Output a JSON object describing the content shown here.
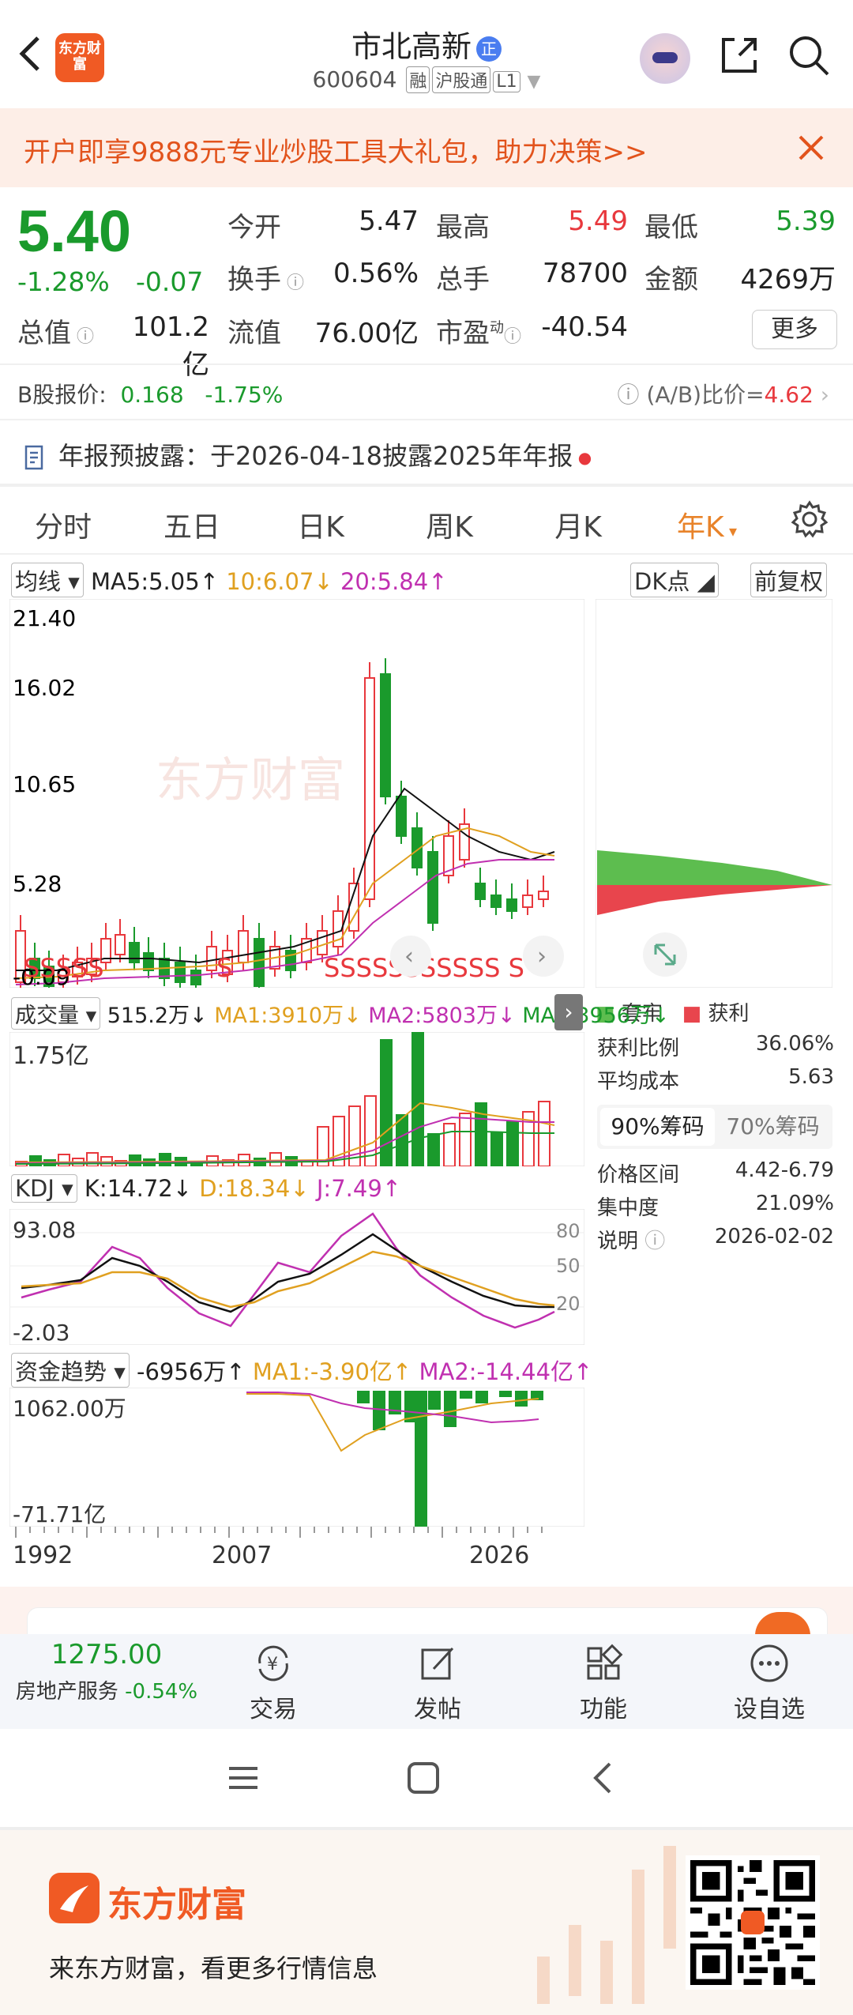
{
  "header": {
    "logo_text": "东方财富",
    "stock_name": "市北高新",
    "badge": "正",
    "stock_code": "600604",
    "tags": [
      "融",
      "沪股通",
      "L1"
    ]
  },
  "banner": {
    "text": "开户即享9888元专业炒股工具大礼包，助力决策>>"
  },
  "quote": {
    "price": "5.40",
    "change_pct": "-1.28%",
    "change": "-0.07",
    "rows": [
      [
        {
          "label": "今开",
          "value": "5.47",
          "color": "#222"
        },
        {
          "label": "最高",
          "value": "5.49",
          "color": "#e8383d"
        },
        {
          "label": "最低",
          "value": "5.39",
          "color": "#1a9a2c"
        }
      ],
      [
        {
          "label": "换手",
          "value": "0.56%",
          "color": "#222"
        },
        {
          "label": "总手",
          "value": "78700",
          "color": "#222"
        },
        {
          "label": "金额",
          "value": "4269万",
          "color": "#222"
        }
      ]
    ],
    "row3": {
      "label1": "总值",
      "value1": "101.2亿",
      "label2": "流值",
      "value2": "76.00亿",
      "label3": "市盈",
      "label3_sup": "动",
      "value3": "-40.54"
    },
    "more_label": "更多"
  },
  "b_share": {
    "label": "B股报价:",
    "price": "0.168",
    "pct": "-1.75%",
    "ratio_label": "(A/B)比价=",
    "ratio_value": "4.62"
  },
  "annual_report": {
    "text": "年报预披露：于2026-04-18披露2025年年报"
  },
  "tabs": [
    "分时",
    "五日",
    "日K",
    "周K",
    "月K",
    "年K"
  ],
  "kchart": {
    "ma_selector": "均线",
    "ma5": "MA5:5.05↑",
    "ma10": "10:6.07↓",
    "ma20": "20:5.84↑",
    "dk_label": "DK点",
    "adjust_label": "前复权",
    "y_labels": [
      "21.40",
      "16.02",
      "10.65",
      "5.28",
      "-0.09"
    ],
    "watermark": "东方财富"
  },
  "chip": {
    "legend_trapped": "套牢",
    "legend_profit": "获利",
    "rows": [
      {
        "label": "获利比例",
        "value": "36.06%"
      },
      {
        "label": "平均成本",
        "value": "5.63"
      }
    ],
    "tab_90": "90%筹码",
    "tab_70": "70%筹码",
    "rows2": [
      {
        "label": "价格区间",
        "value": "4.42-6.79"
      },
      {
        "label": "集中度",
        "value": "21.09%"
      },
      {
        "label": "说明",
        "value": "2026-02-02"
      }
    ]
  },
  "volume": {
    "selector": "成交量",
    "value": "515.2万↓",
    "ma1": "MA1:3910万↓",
    "ma2": "MA2:5803万↓",
    "ma3": "MA3:3956万↓",
    "y_label": "1.75亿"
  },
  "kdj": {
    "selector": "KDJ",
    "k": "K:14.72↓",
    "d": "D:18.34↓",
    "j": "J:7.49↑",
    "y_top": "93.08",
    "y_bottom": "-2.03",
    "r80": "80",
    "r50": "50",
    "r20": "20"
  },
  "fund": {
    "selector": "资金趋势",
    "value": "-6956万↑",
    "ma1": "MA1:-3.90亿↑",
    "ma2": "MA2:-14.44亿↑",
    "y_top": "1062.00万",
    "y_bottom": "-71.71亿"
  },
  "x_axis": [
    "1992",
    "2007",
    "2026"
  ],
  "toolbar": {
    "index_value": "1275.00",
    "index_name": "房地产服务",
    "index_pct": "-0.54%",
    "items": [
      "交易",
      "发帖",
      "功能",
      "设自选"
    ]
  },
  "promo": {
    "brand": "东方财富",
    "slogan": "来东方财富，看更多行情信息"
  }
}
